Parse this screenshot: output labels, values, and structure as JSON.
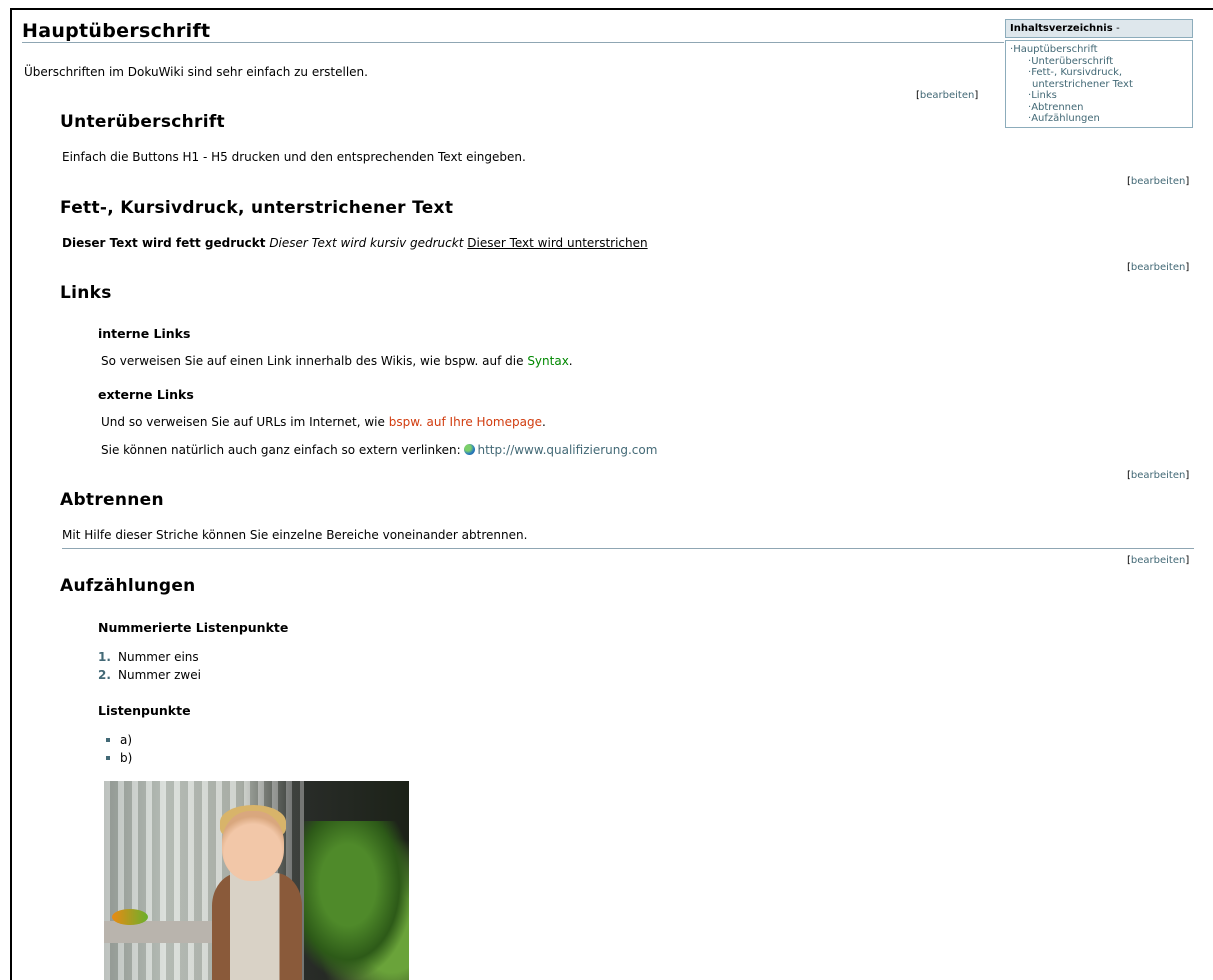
{
  "page": {
    "title": "Hauptüberschrift",
    "intro": "Überschriften im DokuWiki sind sehr einfach zu erstellen.",
    "edit_label": "bearbeiten",
    "edit_open": "[",
    "edit_close": "]"
  },
  "toc": {
    "title": "Inhaltsverzeichnis",
    "toggle": "-",
    "items": [
      {
        "label": "Hauptüberschrift",
        "level": 1
      },
      {
        "label": "Unterüberschrift",
        "level": 2
      },
      {
        "label": "Fett-, Kursivdruck,",
        "level": 2
      },
      {
        "label": "unterstrichener Text",
        "level": 2
      },
      {
        "label": "Links",
        "level": 2
      },
      {
        "label": "Abtrennen",
        "level": 2
      },
      {
        "label": "Aufzählungen",
        "level": 2
      }
    ]
  },
  "sections": {
    "sub": {
      "title": "Unterüberschrift",
      "text": "Einfach die Buttons H1 - H5 drucken und den entsprechenden Text eingeben."
    },
    "format": {
      "title": "Fett-, Kursivdruck, unterstrichener Text",
      "bold": "Dieser Text wird fett gedruckt",
      "italic": "Dieser Text wird kursiv gedruckt",
      "underline": "Dieser Text wird unterstrichen"
    },
    "links": {
      "title": "Links",
      "internal_heading": "interne Links",
      "internal_text": "So verweisen Sie auf einen Link innerhalb des Wikis, wie bspw. auf die ",
      "internal_link": "Syntax",
      "internal_end": ".",
      "external_heading": "externe Links",
      "external_text": "Und so verweisen Sie auf URLs im Internet, wie ",
      "external_link": "bspw. auf Ihre Homepage",
      "external_end": ".",
      "extern_text": "Sie können natürlich auch ganz einfach so extern verlinken: ",
      "extern_url": "http://www.qualifizierung.com"
    },
    "separator": {
      "title": "Abtrennen",
      "text": "Mit Hilfe dieser Striche können Sie einzelne Bereiche voneinander abtrennen."
    },
    "lists": {
      "title": "Aufzählungen",
      "numbered_heading": "Nummerierte Listenpunkte",
      "numbered": [
        {
          "num": "1.",
          "label": "Nummer eins"
        },
        {
          "num": "2.",
          "label": "Nummer zwei"
        }
      ],
      "bullets_heading": "Listenpunkte",
      "bullets": [
        "a)",
        "b)"
      ]
    }
  },
  "colors": {
    "link_internal": "#008800",
    "link_external_wiki": "#d13c0f",
    "link_url": "#436976",
    "rule": "#8fa6b3"
  }
}
